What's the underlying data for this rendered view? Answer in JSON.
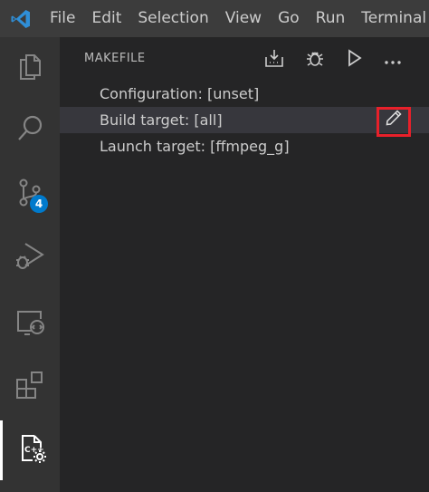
{
  "menubar": {
    "items": [
      "File",
      "Edit",
      "Selection",
      "View",
      "Go",
      "Run",
      "Terminal"
    ]
  },
  "activitybar": {
    "icons": [
      "files-icon",
      "search-icon",
      "source-control-icon",
      "run-debug-icon",
      "remote-explorer-icon",
      "extensions-icon",
      "cpp-makefile-tools-icon"
    ],
    "source_control_badge": "4",
    "active": "cpp-makefile-tools-icon"
  },
  "sidebar": {
    "title": "MAKEFILE",
    "header_actions": [
      "build-icon",
      "debug-icon",
      "run-icon",
      "more-icon"
    ],
    "items": [
      {
        "label": "Configuration: [unset]"
      },
      {
        "label": "Build target: [all]"
      },
      {
        "label": "Launch target: [ffmpeg_g]"
      }
    ],
    "selected_index": 1,
    "highlighted_action": "edit-icon",
    "highlight_color": "#e8202a"
  },
  "colors": {
    "vscode_blue": "#2f8fd8",
    "badge": "#007acc"
  }
}
